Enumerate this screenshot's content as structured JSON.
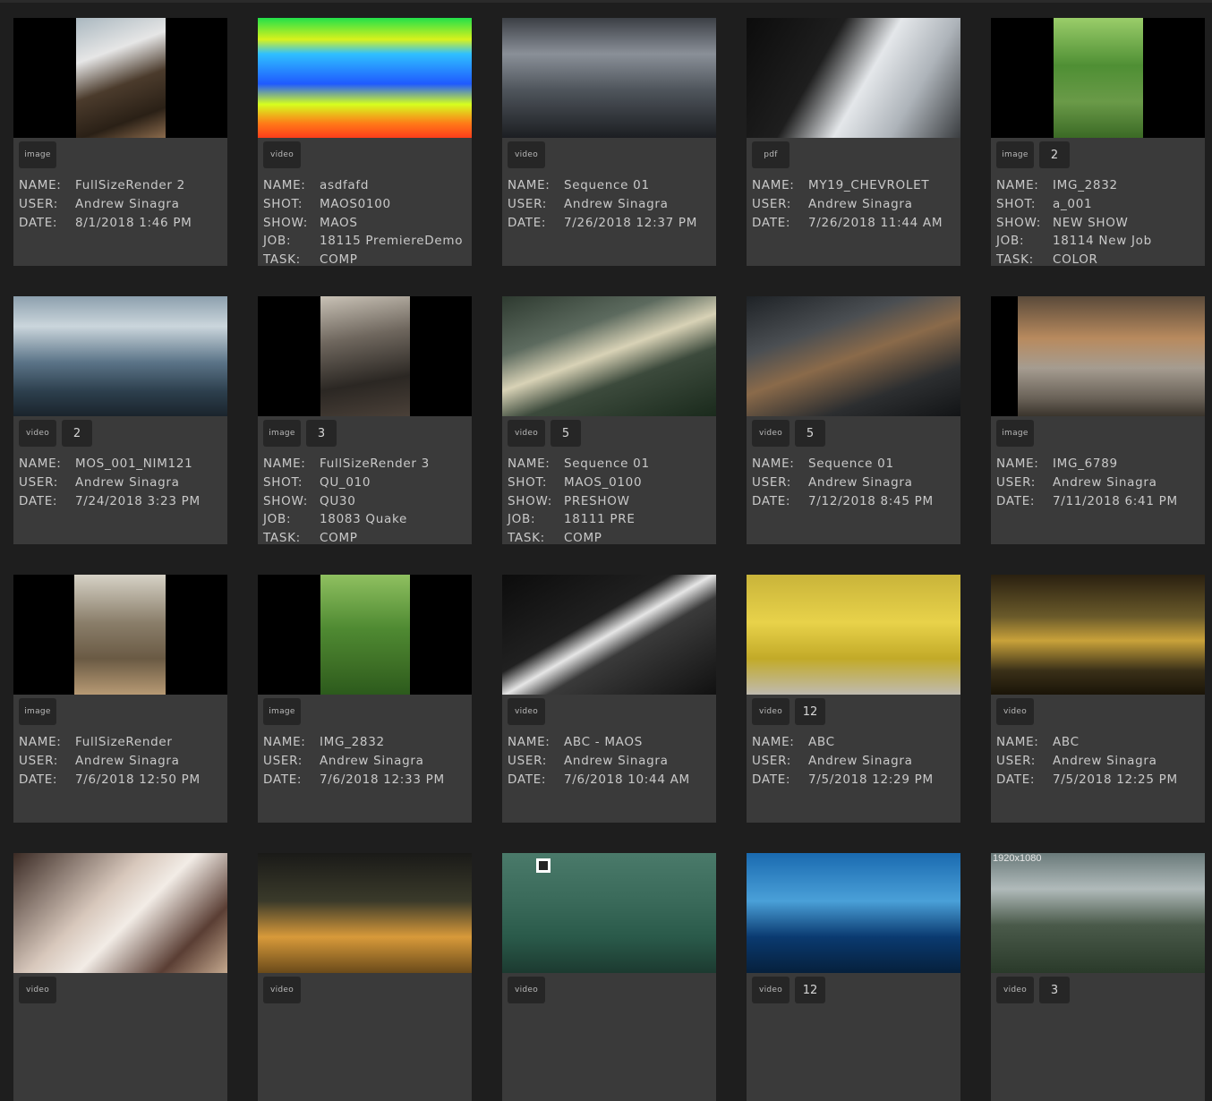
{
  "cards": [
    {
      "type": "image",
      "count": "",
      "art": "linear-gradient(160deg,#a9b7bf 0%,#e6e6e6 30%,#4b3b2c 55%,#2a2016 80%,#8a6a4c 100%)",
      "artClass": "narrow",
      "fields": [
        {
          "k": "NAME:",
          "v": "FullSizeRender 2"
        },
        {
          "k": "USER:",
          "v": "Andrew Sinagra"
        },
        {
          "k": "DATE:",
          "v": "8/1/2018 1:46 PM"
        }
      ]
    },
    {
      "type": "video",
      "count": "",
      "art": "linear-gradient(180deg,#22e04a 0%,#d8f21c 18%,#2fc0ff 30%,#1f5aff 55%,#d6ff1e 72%,#ff7a18 88%,#ff3d1a 100%)",
      "artClass": "full",
      "fields": [
        {
          "k": "NAME:",
          "v": "asdfafd"
        },
        {
          "k": "SHOT:",
          "v": "MAOS0100"
        },
        {
          "k": "SHOW:",
          "v": "MAOS"
        },
        {
          "k": "JOB:",
          "v": "18115 PremiereDemo"
        },
        {
          "k": "TASK:",
          "v": "COMP"
        }
      ]
    },
    {
      "type": "video",
      "count": "",
      "art": "linear-gradient(180deg,#3b3f45 0%,#8a9098 30%,#4f555c 60%,#1c1e22 100%)",
      "artClass": "full",
      "fields": [
        {
          "k": "NAME:",
          "v": "Sequence 01"
        },
        {
          "k": "USER:",
          "v": "Andrew Sinagra"
        },
        {
          "k": "DATE:",
          "v": "7/26/2018 12:37 PM"
        }
      ]
    },
    {
      "type": "pdf",
      "count": "",
      "art": "linear-gradient(120deg,#0c0c0c 0%,#1e1e1e 35%,#e4e7ea 55%,#aeb4ba 75%,#3a3d40 100%)",
      "artClass": "full",
      "fields": [
        {
          "k": "NAME:",
          "v": "MY19_CHEVROLET"
        },
        {
          "k": "USER:",
          "v": "Andrew Sinagra"
        },
        {
          "k": "DATE:",
          "v": "7/26/2018 11:44 AM"
        }
      ]
    },
    {
      "type": "image",
      "count": "2",
      "art": "linear-gradient(180deg,#9acd6a 0%,#4f8f34 40%,#6a9a48 70%,#3b6a25 100%)",
      "artClass": "narrow",
      "fields": [
        {
          "k": "NAME:",
          "v": "IMG_2832"
        },
        {
          "k": "SHOT:",
          "v": "a_001"
        },
        {
          "k": "SHOW:",
          "v": "NEW SHOW"
        },
        {
          "k": "JOB:",
          "v": "18114 New Job"
        },
        {
          "k": "TASK:",
          "v": "COLOR"
        }
      ]
    },
    {
      "type": "video",
      "count": "2",
      "art": "linear-gradient(180deg,#8da0ae 0%,#cbd6dc 25%,#5b7488 55%,#2c3e4c 80%,#1a242c 100%)",
      "artClass": "full",
      "fields": [
        {
          "k": "NAME:",
          "v": "MOS_001_NIM121"
        },
        {
          "k": "USER:",
          "v": "Andrew Sinagra"
        },
        {
          "k": "DATE:",
          "v": "7/24/2018 3:23 PM"
        }
      ]
    },
    {
      "type": "image",
      "count": "3",
      "art": "linear-gradient(170deg,#c9c2b6 0%,#6f675e 35%,#2b2723 70%,#4a4038 100%)",
      "artClass": "narrow",
      "fields": [
        {
          "k": "NAME:",
          "v": "FullSizeRender 3"
        },
        {
          "k": "SHOT:",
          "v": "QU_010"
        },
        {
          "k": "SHOW:",
          "v": "QU30"
        },
        {
          "k": "JOB:",
          "v": "18083 Quake"
        },
        {
          "k": "TASK:",
          "v": "COMP"
        }
      ]
    },
    {
      "type": "video",
      "count": "5",
      "art": "linear-gradient(160deg,#2e3a30 0%,#5c6a5e 30%,#d8d2b6 48%,#3c4a3c 65%,#1a2a1c 100%)",
      "artClass": "full",
      "fields": [
        {
          "k": "NAME:",
          "v": "Sequence 01"
        },
        {
          "k": "SHOT:",
          "v": "MAOS_0100"
        },
        {
          "k": "SHOW:",
          "v": "PRESHOW"
        },
        {
          "k": "JOB:",
          "v": "18111 PRE"
        },
        {
          "k": "TASK:",
          "v": "COMP"
        }
      ]
    },
    {
      "type": "video",
      "count": "5",
      "art": "linear-gradient(160deg,#1e2226 0%,#4a4e52 30%,#8a6a4a 50%,#2c2e30 75%,#121416 100%)",
      "artClass": "full",
      "fields": [
        {
          "k": "NAME:",
          "v": "Sequence 01"
        },
        {
          "k": "USER:",
          "v": "Andrew Sinagra"
        },
        {
          "k": "DATE:",
          "v": "7/12/2018 8:45 PM"
        }
      ]
    },
    {
      "type": "image",
      "count": "",
      "art": "linear-gradient(180deg,#5a4a3a 0%,#b88a5e 35%,#a59c90 60%,#6a6258 85%,#3a342c 100%)",
      "artClass": "tallish",
      "fields": [
        {
          "k": "NAME:",
          "v": "IMG_6789"
        },
        {
          "k": "USER:",
          "v": "Andrew Sinagra"
        },
        {
          "k": "DATE:",
          "v": "7/11/2018 6:41 PM"
        }
      ]
    },
    {
      "type": "image",
      "count": "",
      "art": "linear-gradient(180deg,#d6d2c6 0%,#8a7e6a 40%,#6a5a44 70%,#b79a74 100%)",
      "artClass": "mid",
      "fields": [
        {
          "k": "NAME:",
          "v": "FullSizeRender"
        },
        {
          "k": "USER:",
          "v": "Andrew Sinagra"
        },
        {
          "k": "DATE:",
          "v": "7/6/2018 12:50 PM"
        }
      ]
    },
    {
      "type": "image",
      "count": "",
      "art": "linear-gradient(180deg,#8fc060 0%,#4f8a32 45%,#3e7026 75%,#2c5a1c 100%)",
      "artClass": "narrow",
      "fields": [
        {
          "k": "NAME:",
          "v": "IMG_2832"
        },
        {
          "k": "USER:",
          "v": "Andrew Sinagra"
        },
        {
          "k": "DATE:",
          "v": "7/6/2018 12:33 PM"
        }
      ]
    },
    {
      "type": "video",
      "count": "",
      "art": "linear-gradient(150deg,#0c0c0c 0%,#202020 40%,#e6e6e6 50%,#3a3a3a 60%,#111 100%)",
      "artClass": "full",
      "fields": [
        {
          "k": "NAME:",
          "v": "ABC - MAOS"
        },
        {
          "k": "USER:",
          "v": "Andrew Sinagra"
        },
        {
          "k": "DATE:",
          "v": "7/6/2018 10:44 AM"
        }
      ]
    },
    {
      "type": "video",
      "count": "12",
      "art": "linear-gradient(180deg,#c9b43a 0%,#e8d24a 40%,#c2aa28 70%,#bfbab0 100%)",
      "artClass": "full",
      "fields": [
        {
          "k": "NAME:",
          "v": "ABC"
        },
        {
          "k": "USER:",
          "v": "Andrew Sinagra"
        },
        {
          "k": "DATE:",
          "v": "7/5/2018 12:29 PM"
        }
      ]
    },
    {
      "type": "video",
      "count": "",
      "art": "linear-gradient(180deg,#2a2010 0%,#6a5a2a 35%,#c9a23a 55%,#3a3018 80%,#1a1408 100%)",
      "artClass": "full",
      "fields": [
        {
          "k": "NAME:",
          "v": "ABC"
        },
        {
          "k": "USER:",
          "v": "Andrew Sinagra"
        },
        {
          "k": "DATE:",
          "v": "7/5/2018 12:25 PM"
        }
      ]
    },
    {
      "type": "video",
      "count": "",
      "art": "linear-gradient(135deg,#3a2a24 0%,#d8c8bc 40%,#f2ece6 55%,#5a3e34 80%,#c4a88e 100%)",
      "artClass": "full",
      "fields": []
    },
    {
      "type": "video",
      "count": "",
      "art": "linear-gradient(180deg,#1a1a18 0%,#3a3a2a 40%,#d89a3a 70%,#6a4a1a 100%)",
      "artClass": "full",
      "fields": []
    },
    {
      "type": "video",
      "count": "",
      "art": "linear-gradient(180deg,#4a7a6a 0%,#3a6a5a 40%,#2a5a4a 70%,#1c3a30 100%)",
      "artClass": "full",
      "fields": [],
      "chip": true
    },
    {
      "type": "video",
      "count": "12",
      "art": "linear-gradient(180deg,#1a6ab0 0%,#4aa0d8 40%,#0a3a70 70%,#06203c 100%)",
      "artClass": "full",
      "fields": []
    },
    {
      "type": "video",
      "count": "3",
      "art": "linear-gradient(180deg,#6a7a7a 0%,#b0baba 30%,#4a5a4a 60%,#2a3a2a 100%)",
      "artClass": "full",
      "fields": [],
      "res": "1920x1080"
    }
  ]
}
